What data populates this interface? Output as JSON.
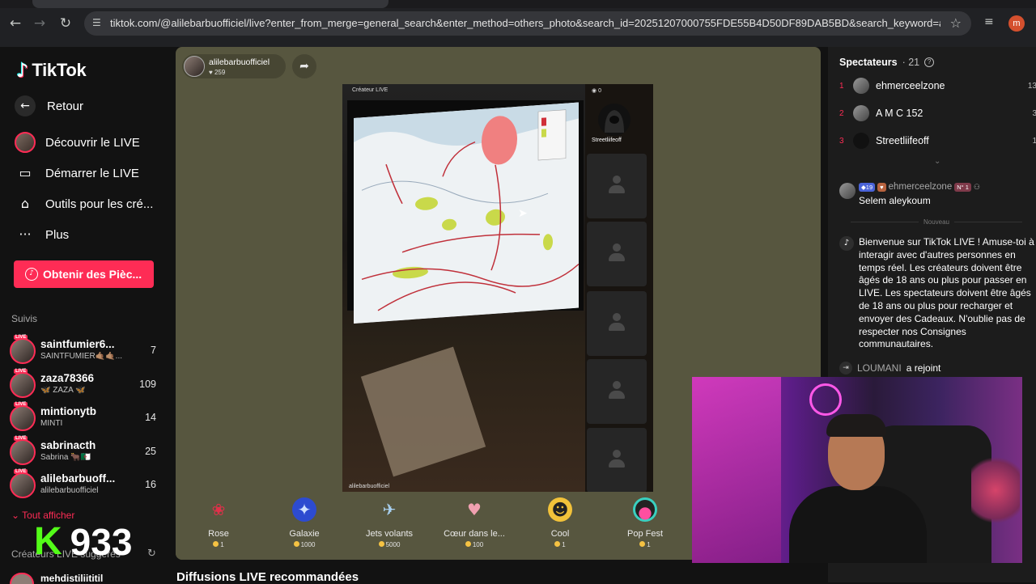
{
  "browser": {
    "url": "tiktok.com/@alilebarbuofficiel/live?enter_from_merge=general_search&enter_method=others_photo&search_id=20251207000755FDE55B4D50DF89DAB5BD&search_keyword=a...",
    "profile_initial": "m"
  },
  "sidebar": {
    "logo_text": "TikTok",
    "back_label": "Retour",
    "menu": [
      {
        "label": "Découvrir le LIVE",
        "icon": "avatar"
      },
      {
        "label": "Démarrer le LIVE",
        "icon": "camera-icon"
      },
      {
        "label": "Outils pour les cré...",
        "icon": "play-house-icon"
      },
      {
        "label": "Plus",
        "icon": "more-icon"
      }
    ],
    "coins_button": "Obtenir des Pièc...",
    "following_title": "Suivis",
    "following": [
      {
        "name": "saintfumier6...",
        "sub": "SAINTFUMIER🤙🏽🤙🏽...",
        "count": "7"
      },
      {
        "name": "zaza78366",
        "sub": "🦋 ZAZA 🦋",
        "count": "109"
      },
      {
        "name": "mintionytb",
        "sub": "MINTI",
        "count": "14"
      },
      {
        "name": "sabrinacth",
        "sub": "Sabrina 🐂🇩🇿",
        "count": "25"
      },
      {
        "name": "alilebarbuoff...",
        "sub": "alilebarbuofficiel",
        "count": "16"
      }
    ],
    "show_all": "Tout afficher",
    "suggested_title": "Créateurs LIVE suggérés",
    "next_suggested": "mehdistiliititil",
    "overlay_k": "K",
    "overlay_number": "933"
  },
  "stage": {
    "host_name": "alilebarbuofficiel",
    "host_likes": "♥ 259",
    "creator_label": "Créateur LIVE",
    "guest_count": "0",
    "guest_name": "Streetliifeoff",
    "bottom_label": "alilebarbuofficiel",
    "gifts": [
      {
        "name": "Rose",
        "price": "1",
        "icon": "🌹",
        "color": "#c9223a"
      },
      {
        "name": "Galaxie",
        "price": "1000",
        "icon": "✦",
        "color": "#3b5bd6"
      },
      {
        "name": "Jets volants",
        "price": "5000",
        "icon": "✈",
        "color": "#4a8cc9"
      },
      {
        "name": "Cœur dans le...",
        "price": "100",
        "icon": "♥",
        "color": "#e0a07e"
      },
      {
        "name": "Cool",
        "price": "1",
        "icon": "😎",
        "color": "#f2c23a"
      },
      {
        "name": "Pop Fest",
        "price": "1",
        "icon": "●",
        "color": "#7a3fd6"
      }
    ]
  },
  "recommended_title": "Diffusions LIVE recommandées",
  "chat": {
    "viewers_title": "Spectateurs",
    "viewers_count": "· 21",
    "viewers": [
      {
        "rank": "1",
        "name": "ehmerceelzone",
        "score": "13"
      },
      {
        "rank": "2",
        "name": "A M C 152",
        "score": "3"
      },
      {
        "rank": "3",
        "name": "Streetliifeoff",
        "score": "1"
      }
    ],
    "message": {
      "level": "19",
      "fan": "♥",
      "name": "ehmerceelzone",
      "top": "N° 1",
      "text": "Selem aleykoum"
    },
    "new_label": "Nouveau",
    "welcome": "Bienvenue sur TikTok LIVE ! Amuse-toi à interagir avec d'autres personnes en temps réel. Les créateurs doivent être âgés de 18 ans ou plus pour passer en LIVE. Les spectateurs doivent être âgés de 18 ans ou plus pour recharger et envoyer des Cadeaux. N'oublie pas de respecter nos Consignes communautaires.",
    "joined_name": "LOUMANI",
    "joined_text": "a rejoint"
  }
}
